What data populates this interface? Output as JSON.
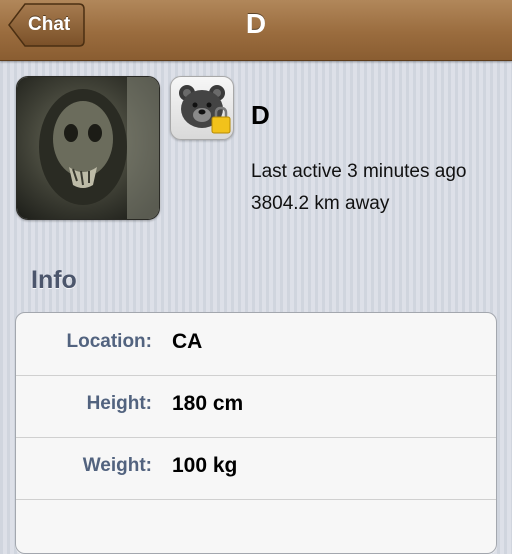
{
  "navbar": {
    "back_label": "Chat",
    "title": "D"
  },
  "profile": {
    "name": "D",
    "last_active": "Last active 3 minutes ago",
    "distance": "3804.2 km away",
    "avatar_icon": "profile-photo",
    "badge_icon": "locked-bear-icon"
  },
  "info": {
    "section_title": "Info",
    "rows": [
      {
        "label": "Location:",
        "value": "CA"
      },
      {
        "label": "Height:",
        "value": "180 cm"
      },
      {
        "label": "Weight:",
        "value": "100 kg"
      }
    ]
  },
  "colors": {
    "navbar": "#9a6c3e",
    "label_text": "#52637f",
    "section_header": "#4c566c",
    "background": "#d4d8e1"
  }
}
